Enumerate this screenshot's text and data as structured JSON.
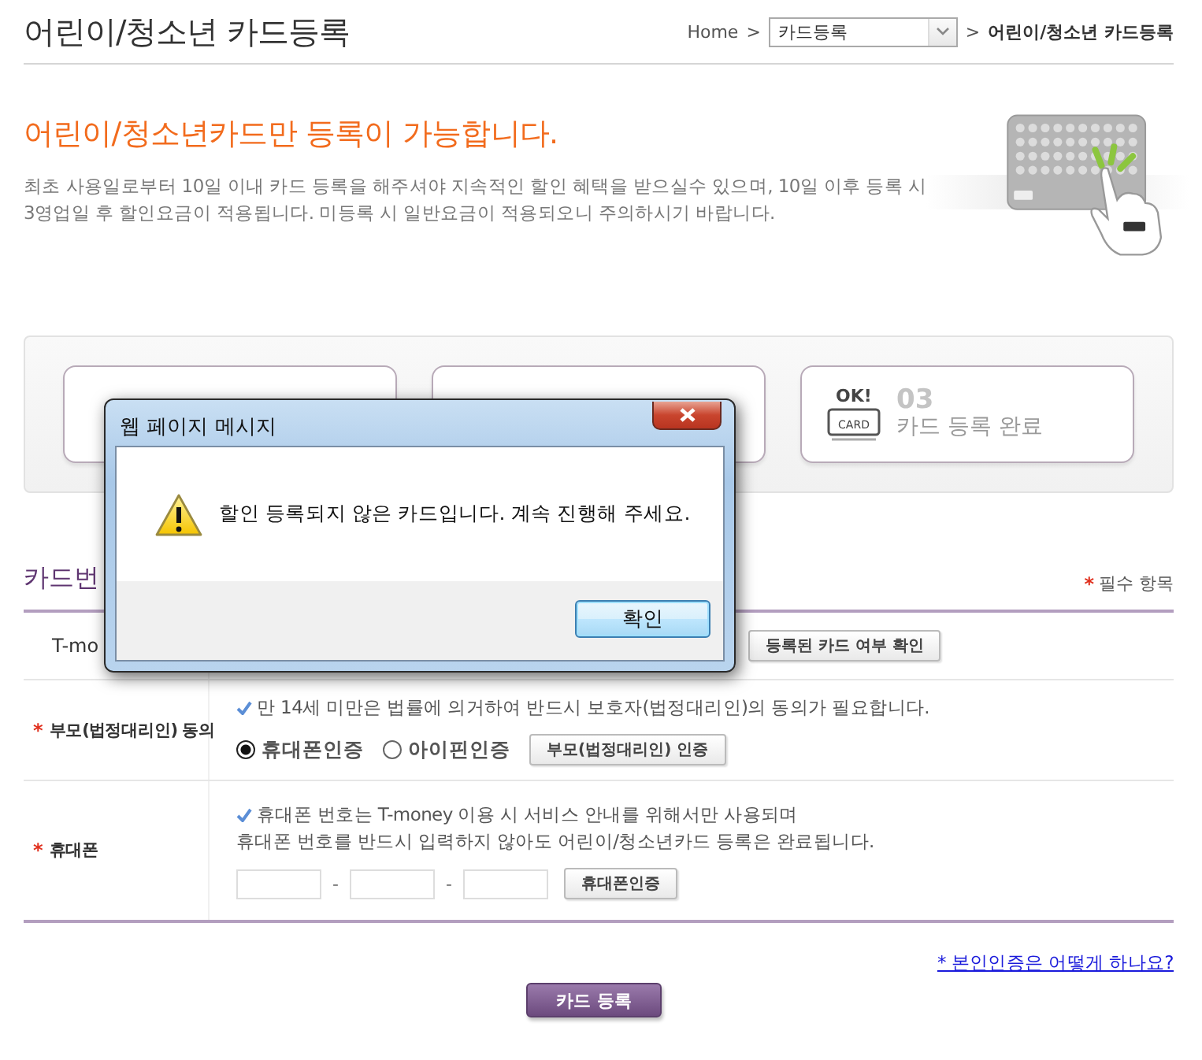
{
  "page": {
    "title": "어린이/청소년 카드등록"
  },
  "breadcrumb": {
    "home": "Home",
    "separator_1": ">",
    "select_value": "카드등록",
    "separator_2": ">",
    "current": "어린이/청소년 카드등록"
  },
  "notice": {
    "heading": "어린이/청소년카드만 등록이 가능합니다.",
    "description_lines": [
      "최초 사용일로부터 10일 이내 카드 등록을 해주셔야 지속적인 할인 혜택을 받으실수 있으며, 10일 이후 등록 시",
      "3영업일 후 할인요금이 적용됩니다. 미등록 시 일반요금이 적용되오니 주의하시기 바랍니다."
    ]
  },
  "steps": [
    {
      "kind": "covered"
    },
    {
      "kind": "covered"
    },
    {
      "kind": "complete",
      "icon_text": "OK!",
      "icon_caption": "CARD",
      "number": "03",
      "label": "카드 등록 완료"
    }
  ],
  "section": {
    "title": "카드번",
    "required_mark": "*",
    "required_label": "필수 항목"
  },
  "form_rows": [
    {
      "kind": "card",
      "label": "T-mo",
      "button": "등록된 카드 여부 확인"
    },
    {
      "kind": "consent",
      "mark": "*",
      "label": "부모(법정대리인) 동의",
      "note": "만 14세 미만은 법률에 의거하여 반드시 보호자(법정대리인)의 동의가 필요합니다.",
      "options": [
        {
          "label": "휴대폰인증",
          "selected": true
        },
        {
          "label": "아이핀인증",
          "selected": false
        }
      ],
      "button": "부모(법정대리인) 인증"
    },
    {
      "kind": "phone",
      "mark": "*",
      "label": "휴대폰",
      "note_lines": [
        "휴대폰 번호는 T-money 이용 시 서비스 안내를 위해서만 사용되며",
        "휴대폰 번호를 반드시 입력하지 않아도 어린이/청소년카드 등록은 완료됩니다."
      ],
      "separators": [
        "-",
        "-"
      ],
      "button": "휴대폰인증"
    }
  ],
  "help_link": "* 본인인증은 어떻게 하나요?",
  "submit_button": "카드 등록",
  "dialog": {
    "title": "웹 페이지 메시지",
    "message": "할인 등록되지 않은 카드입니다. 계속 진행해 주세요.",
    "button": "확인"
  }
}
